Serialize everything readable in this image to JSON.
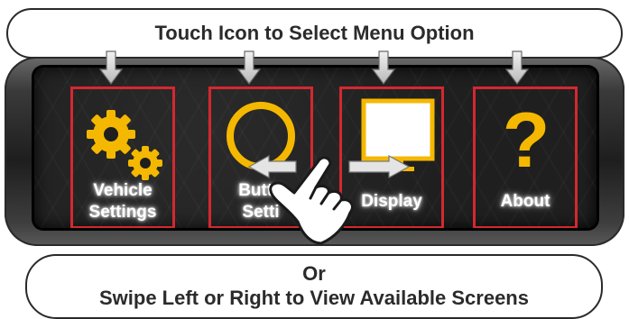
{
  "instructions": {
    "top_text": "Touch Icon to Select Menu Option",
    "bottom_line1": "Or",
    "bottom_line2": "Swipe Left or Right to View Available Screens"
  },
  "menu": {
    "items": [
      {
        "id": "vehicle-settings",
        "line1": "Vehicle",
        "line2": "Settings",
        "icon": "gears-icon"
      },
      {
        "id": "button-settings",
        "line1": "Butto",
        "line2": "Setti",
        "icon": "circle-icon"
      },
      {
        "id": "display",
        "line1": "Display",
        "line2": "",
        "icon": "display-icon"
      },
      {
        "id": "about",
        "line1": "About",
        "line2": "",
        "icon": "question-icon",
        "icon_text": "?"
      }
    ]
  },
  "colors": {
    "tile_border": "#d42830",
    "icon_yellow": "#f5b800",
    "arrow_gray": "#b8b8b8",
    "callout_border": "#2a2a2a"
  }
}
